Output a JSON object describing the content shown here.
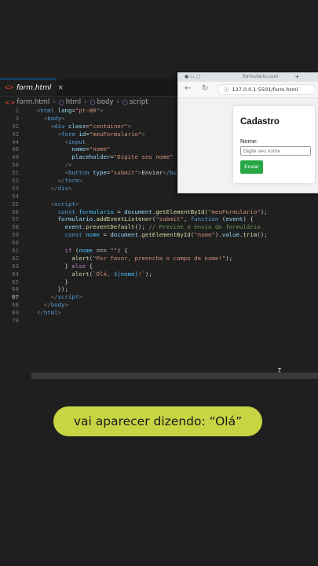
{
  "editor": {
    "tab": {
      "icon": "<>",
      "label": "form.html",
      "close": "×"
    },
    "breadcrumb": [
      "form.html",
      "html",
      "body",
      "script"
    ],
    "lines": [
      {
        "num": "2",
        "tokens": [
          [
            "t",
            "  <"
          ],
          [
            "tg",
            "html"
          ],
          [
            "at",
            " lang"
          ],
          [
            "pl",
            "="
          ],
          [
            "st",
            "\"pt-BR\""
          ],
          [
            "t",
            ">"
          ]
        ]
      },
      {
        "num": "3",
        "tokens": [
          [
            "t",
            "    <"
          ],
          [
            "tg",
            "body"
          ],
          [
            "t",
            ">"
          ]
        ]
      },
      {
        "num": "42",
        "tokens": [
          [
            "t",
            "      <"
          ],
          [
            "tg",
            "div"
          ],
          [
            "at",
            " class"
          ],
          [
            "pl",
            "="
          ],
          [
            "st",
            "\"container\""
          ],
          [
            "t",
            ">"
          ]
        ]
      },
      {
        "num": "43",
        "tokens": [
          [
            "t",
            "        <"
          ],
          [
            "tg",
            "form"
          ],
          [
            "at",
            " id"
          ],
          [
            "pl",
            "="
          ],
          [
            "st",
            "\"meuFormulario\""
          ],
          [
            "t",
            ">"
          ]
        ]
      },
      {
        "num": "44",
        "tokens": [
          [
            "t",
            "          <"
          ],
          [
            "tg",
            "input"
          ]
        ]
      },
      {
        "num": "48",
        "tokens": [
          [
            "at",
            "            name"
          ],
          [
            "pl",
            "="
          ],
          [
            "st",
            "\"nome\""
          ]
        ]
      },
      {
        "num": "49",
        "tokens": [
          [
            "at",
            "            placeholder"
          ],
          [
            "pl",
            "="
          ],
          [
            "st",
            "\"Digite seu nome\""
          ]
        ]
      },
      {
        "num": "50",
        "tokens": [
          [
            "t",
            "          />"
          ]
        ]
      },
      {
        "num": "51",
        "tokens": [
          [
            "t",
            "          <"
          ],
          [
            "tg",
            "button"
          ],
          [
            "at",
            " type"
          ],
          [
            "pl",
            "="
          ],
          [
            "st",
            "\"submit\""
          ],
          [
            "t",
            ">"
          ],
          [
            "pl",
            "Enviar"
          ],
          [
            "t",
            "</"
          ],
          [
            "tg",
            "bu"
          ]
        ]
      },
      {
        "num": "52",
        "tokens": [
          [
            "t",
            "        </"
          ],
          [
            "tg",
            "form"
          ],
          [
            "t",
            ">"
          ]
        ]
      },
      {
        "num": "53",
        "tokens": [
          [
            "t",
            "      </"
          ],
          [
            "tg",
            "div"
          ],
          [
            "t",
            ">"
          ]
        ]
      },
      {
        "num": "54",
        "tokens": []
      },
      {
        "num": "55",
        "tokens": [
          [
            "t",
            "      <"
          ],
          [
            "tg",
            "script"
          ],
          [
            "t",
            ">"
          ]
        ]
      },
      {
        "num": "56",
        "tokens": [
          [
            "kw",
            "        const"
          ],
          [
            "cst",
            " formulario"
          ],
          [
            "pl",
            " = "
          ],
          [
            "vr",
            "document"
          ],
          [
            "pl",
            "."
          ],
          [
            "fn",
            "getElementById"
          ],
          [
            "pl",
            "("
          ],
          [
            "st",
            "\"meuFormulario\""
          ],
          [
            "pl",
            ");"
          ]
        ]
      },
      {
        "num": "57",
        "tokens": [
          [
            "vr",
            "        formulario"
          ],
          [
            "pl",
            "."
          ],
          [
            "fn",
            "addEventListener"
          ],
          [
            "pl",
            "("
          ],
          [
            "st",
            "\"submit\""
          ],
          [
            "pl",
            ", "
          ],
          [
            "kw",
            "function"
          ],
          [
            "pl",
            " ("
          ],
          [
            "vr",
            "event"
          ],
          [
            "pl",
            ") {"
          ]
        ]
      },
      {
        "num": "58",
        "tokens": [
          [
            "vr",
            "          event"
          ],
          [
            "pl",
            "."
          ],
          [
            "fn",
            "preventDefault"
          ],
          [
            "pl",
            "(); "
          ],
          [
            "cm",
            "// Previne o envio do formulário"
          ]
        ]
      },
      {
        "num": "59",
        "tokens": [
          [
            "kw",
            "          const"
          ],
          [
            "cst",
            " nome"
          ],
          [
            "pl",
            " = "
          ],
          [
            "vr",
            "document"
          ],
          [
            "pl",
            "."
          ],
          [
            "fn",
            "getElementById"
          ],
          [
            "pl",
            "("
          ],
          [
            "st",
            "\"nome\""
          ],
          [
            "pl",
            ")."
          ],
          [
            "vr",
            "value"
          ],
          [
            "pl",
            "."
          ],
          [
            "fn",
            "trim"
          ],
          [
            "pl",
            "();"
          ]
        ]
      },
      {
        "num": "60",
        "tokens": []
      },
      {
        "num": "61",
        "tokens": [
          [
            "pk",
            "          if"
          ],
          [
            "pl",
            " ("
          ],
          [
            "cst",
            "nome"
          ],
          [
            "pl",
            " === "
          ],
          [
            "st",
            "\"\""
          ],
          [
            "pl",
            ") {"
          ]
        ]
      },
      {
        "num": "62",
        "tokens": [
          [
            "fn",
            "            alert"
          ],
          [
            "pl",
            "("
          ],
          [
            "st",
            "\"Por favor, preencha o campo de nome!\""
          ],
          [
            "pl",
            ");"
          ]
        ]
      },
      {
        "num": "63",
        "tokens": [
          [
            "pl",
            "          } "
          ],
          [
            "pk",
            "else"
          ],
          [
            "pl",
            " {"
          ]
        ]
      },
      {
        "num": "64",
        "tokens": [
          [
            "fn",
            "            alert"
          ],
          [
            "pl",
            "("
          ],
          [
            "st",
            "`Olá, "
          ],
          [
            "kw",
            "${"
          ],
          [
            "cst",
            "nome"
          ],
          [
            "kw",
            "}"
          ],
          [
            "st",
            "!`"
          ],
          [
            "pl",
            ");"
          ]
        ]
      },
      {
        "num": "65",
        "tokens": [
          [
            "pl",
            "          }"
          ]
        ]
      },
      {
        "num": "66",
        "tokens": [
          [
            "pl",
            "        });"
          ]
        ]
      },
      {
        "num": "67",
        "active": true,
        "tokens": [
          [
            "t",
            "      </"
          ],
          [
            "tg",
            "script"
          ],
          [
            "t",
            ">"
          ]
        ]
      },
      {
        "num": "68",
        "tokens": [
          [
            "t",
            "    </"
          ],
          [
            "tg",
            "body"
          ],
          [
            "t",
            ">"
          ]
        ]
      },
      {
        "num": "69",
        "tokens": [
          [
            "t",
            "  </"
          ],
          [
            "tg",
            "html"
          ],
          [
            "t",
            ">"
          ]
        ]
      },
      {
        "num": "70",
        "tokens": []
      }
    ]
  },
  "browser": {
    "tab_text": "formulario.com",
    "url": "127.0.0.1:5501/form.html",
    "card": {
      "title": "Cadastro",
      "label": "Nome:",
      "placeholder": "Digite seu nome",
      "button": "Enviar"
    }
  },
  "caption": "vai aparecer dizendo: “Olá”",
  "colors": {
    "caption_bg": "#c7d444",
    "editor_bg": "#1f1f1f",
    "button_green": "#28a745"
  }
}
